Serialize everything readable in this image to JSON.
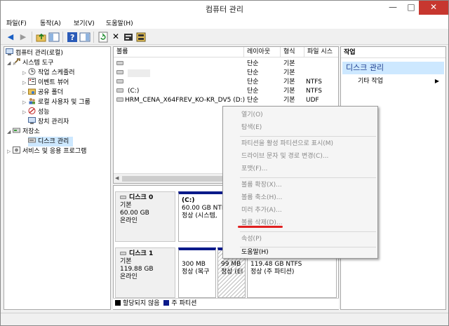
{
  "window": {
    "title": "컴퓨터 관리",
    "min": "—",
    "max": "□",
    "close": "✕"
  },
  "menubar": [
    "파일(F)",
    "동작(A)",
    "보기(V)",
    "도움말(H)"
  ],
  "tree": {
    "root": "컴퓨터 관리(로컬)",
    "system_tools": "시스템 도구",
    "task_scheduler": "작업 스케줄러",
    "event_viewer": "이벤트 뷰어",
    "shared_folders": "공유 폴더",
    "local_users": "로컬 사용자 및 그룹",
    "performance": "성능",
    "device_manager": "장치 관리자",
    "storage": "저장소",
    "disk_management": "디스크 관리",
    "services": "서비스 및 응용 프로그램"
  },
  "volume_list": {
    "columns": [
      "볼륨",
      "레이아웃",
      "형식",
      "파일 시스"
    ],
    "rows": [
      {
        "name": "",
        "layout": "단순",
        "type": "기본",
        "fs": ""
      },
      {
        "name": "",
        "layout": "단순",
        "type": "기본",
        "fs": ""
      },
      {
        "name": "",
        "layout": "단순",
        "type": "기본",
        "fs": "NTFS"
      },
      {
        "name": "(C:)",
        "layout": "단순",
        "type": "기본",
        "fs": "NTFS"
      },
      {
        "name": "HRM_CENA_X64FREV_KO-KR_DV5 (D:)",
        "layout": "단순",
        "type": "기본",
        "fs": "UDF"
      }
    ]
  },
  "disks": [
    {
      "name": "디스크 0",
      "type": "기본",
      "size": "60.00 GB",
      "status": "온라인",
      "partitions": [
        {
          "line1": "(C:)",
          "line2": "60.00 GB NTFS",
          "line3": "정상 (시스템,"
        }
      ]
    },
    {
      "name": "디스크 1",
      "type": "기본",
      "size": "119.88 GB",
      "status": "온라인",
      "partitions": [
        {
          "line1": "",
          "line2": "300 MB",
          "line3": "정상 (복구"
        },
        {
          "line1": "",
          "line2": "99 MB",
          "line3": "정상 (El"
        },
        {
          "line1": "",
          "line2": "119.48 GB NTFS",
          "line3": "정상 (주 파티션)"
        }
      ]
    }
  ],
  "legend": {
    "unallocated": "할당되지 않음",
    "primary": "주 파티션"
  },
  "actions": {
    "header": "작업",
    "section": "디스크 관리",
    "more": "기타 작업",
    "arrow": "▶"
  },
  "context_menu": [
    {
      "label": "열기(O)",
      "enabled": false
    },
    {
      "label": "탐색(E)",
      "enabled": false
    },
    {
      "label": "파티션을 활성 파티션으로 표시(M)",
      "enabled": false
    },
    {
      "label": "드라이브 문자 및 경로 변경(C)...",
      "enabled": false
    },
    {
      "label": "포맷(F)...",
      "enabled": false
    },
    {
      "label": "볼륨 확장(X)...",
      "enabled": false
    },
    {
      "label": "볼륨 축소(H)...",
      "enabled": false
    },
    {
      "label": "미러 추가(A)...",
      "enabled": false
    },
    {
      "label": "볼륨 삭제(D)...",
      "enabled": false
    },
    {
      "label": "속성(P)",
      "enabled": false
    },
    {
      "label": "도움말(H)",
      "enabled": true
    }
  ],
  "colors": {
    "primary_partition": "#0a1a8a",
    "unallocated": "#000000",
    "selection": "#cde8ff",
    "close_button": "#c7372f",
    "annotation": "#e02020"
  }
}
